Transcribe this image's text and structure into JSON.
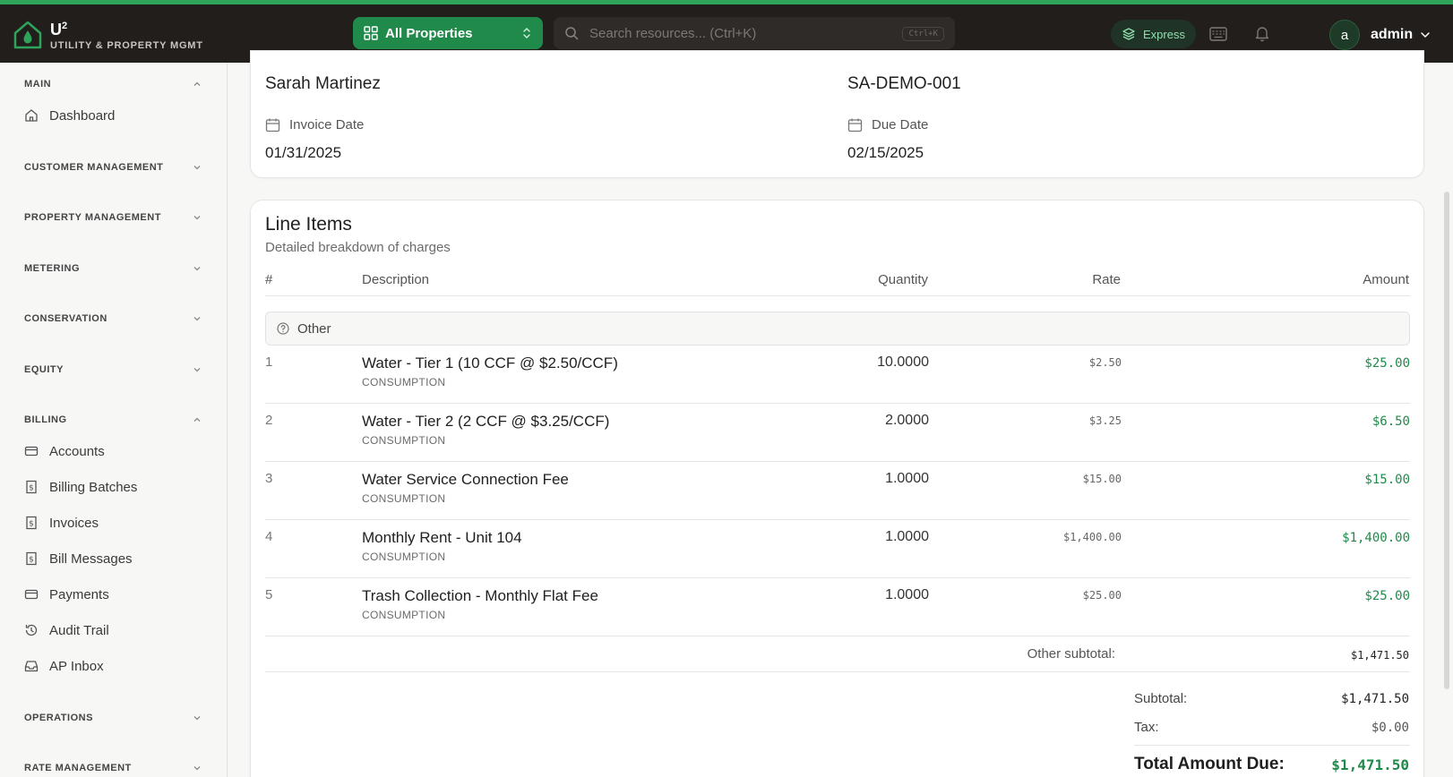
{
  "header": {
    "brand": "U",
    "brand_sup": "2",
    "brand_sub": "UTILITY & PROPERTY MGMT",
    "property_select": "All Properties",
    "search_placeholder": "Search resources... (Ctrl+K)",
    "search_shortcut": "Ctrl+K",
    "express_label": "Express",
    "avatar_initial": "a",
    "user_name": "admin"
  },
  "sidebar": {
    "main": {
      "label": "MAIN",
      "items": [
        {
          "label": "Dashboard",
          "icon": "home-icon"
        }
      ]
    },
    "customer_management": "CUSTOMER MANAGEMENT",
    "property_management": "PROPERTY MANAGEMENT",
    "metering": "METERING",
    "conservation": "CONSERVATION",
    "equity": "EQUITY",
    "billing": {
      "label": "BILLING",
      "items": [
        {
          "label": "Accounts",
          "icon": "credit-card-icon"
        },
        {
          "label": "Billing Batches",
          "icon": "receipt-icon"
        },
        {
          "label": "Invoices",
          "icon": "receipt-icon"
        },
        {
          "label": "Bill Messages",
          "icon": "receipt-icon"
        },
        {
          "label": "Payments",
          "icon": "credit-card-icon"
        },
        {
          "label": "Audit Trail",
          "icon": "history-icon"
        },
        {
          "label": "AP Inbox",
          "icon": "inbox-icon"
        }
      ]
    },
    "operations": "OPERATIONS",
    "rate_management": "RATE MANAGEMENT"
  },
  "invoice": {
    "customer_name": "Sarah Martinez",
    "account_number": "SA-DEMO-001",
    "invoice_date_label": "Invoice Date",
    "invoice_date": "01/31/2025",
    "due_date_label": "Due Date",
    "due_date": "02/15/2025"
  },
  "line_items": {
    "title": "Line Items",
    "subtitle": "Detailed breakdown of charges",
    "columns": {
      "num": "#",
      "description": "Description",
      "quantity": "Quantity",
      "rate": "Rate",
      "amount": "Amount"
    },
    "group_label": "Other",
    "rows": [
      {
        "num": "1",
        "description": "Water - Tier 1 (10 CCF @ $2.50/CCF)",
        "type": "CONSUMPTION",
        "quantity": "10.0000",
        "rate": "$2.50",
        "amount": "$25.00"
      },
      {
        "num": "2",
        "description": "Water - Tier 2 (2 CCF @ $3.25/CCF)",
        "type": "CONSUMPTION",
        "quantity": "2.0000",
        "rate": "$3.25",
        "amount": "$6.50"
      },
      {
        "num": "3",
        "description": "Water Service Connection Fee",
        "type": "CONSUMPTION",
        "quantity": "1.0000",
        "rate": "$15.00",
        "amount": "$15.00"
      },
      {
        "num": "4",
        "description": "Monthly Rent - Unit 104",
        "type": "CONSUMPTION",
        "quantity": "1.0000",
        "rate": "$1,400.00",
        "amount": "$1,400.00"
      },
      {
        "num": "5",
        "description": "Trash Collection - Monthly Flat Fee",
        "type": "CONSUMPTION",
        "quantity": "1.0000",
        "rate": "$25.00",
        "amount": "$25.00"
      }
    ],
    "group_subtotal_label": "Other subtotal:",
    "group_subtotal": "$1,471.50",
    "subtotal_label": "Subtotal:",
    "subtotal": "$1,471.50",
    "tax_label": "Tax:",
    "tax": "$0.00",
    "total_label": "Total Amount Due:",
    "total": "$1,471.50"
  },
  "colors": {
    "accent": "#1f8a4a",
    "topbar": "#211e1c",
    "top_stripe": "#2ea35a"
  }
}
